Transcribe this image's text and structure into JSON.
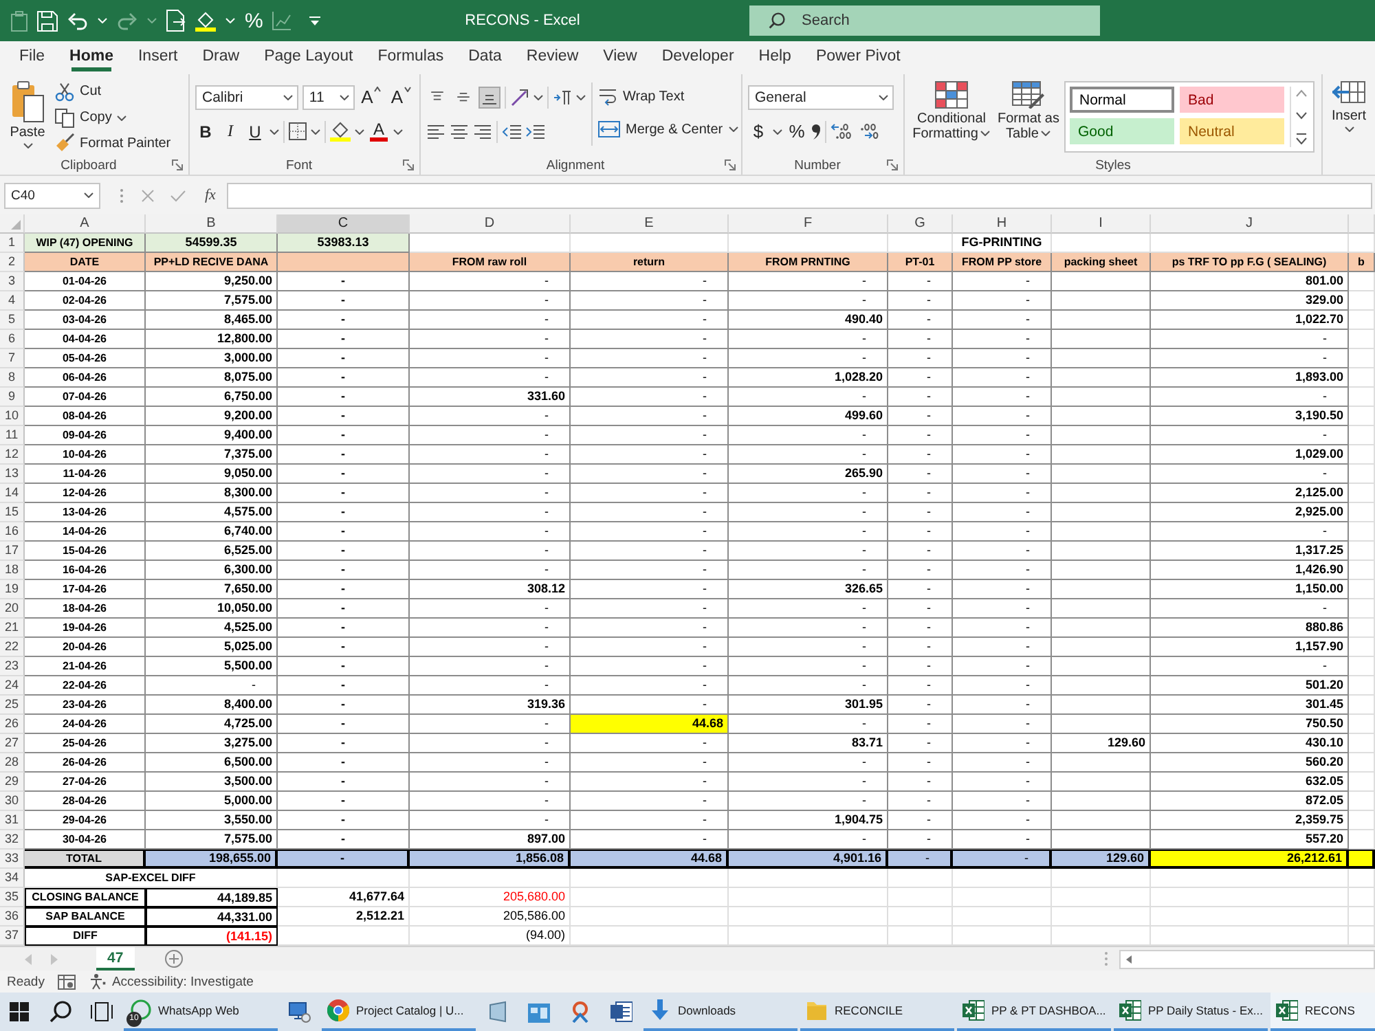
{
  "window": {
    "title": "RECONS - Excel"
  },
  "quick_access": {
    "percent": "%"
  },
  "search": {
    "placeholder": "Search"
  },
  "ribbon_tabs": [
    {
      "label": "File",
      "selected": false
    },
    {
      "label": "Home",
      "selected": true
    },
    {
      "label": "Insert",
      "selected": false
    },
    {
      "label": "Draw",
      "selected": false
    },
    {
      "label": "Page Layout",
      "selected": false
    },
    {
      "label": "Formulas",
      "selected": false
    },
    {
      "label": "Data",
      "selected": false
    },
    {
      "label": "Review",
      "selected": false
    },
    {
      "label": "View",
      "selected": false
    },
    {
      "label": "Developer",
      "selected": false
    },
    {
      "label": "Help",
      "selected": false
    },
    {
      "label": "Power Pivot",
      "selected": false
    }
  ],
  "clipboard": {
    "paste": "Paste",
    "cut": "Cut",
    "copy": "Copy",
    "format_painter": "Format Painter",
    "label": "Clipboard"
  },
  "font": {
    "name": "Calibri",
    "size": "11",
    "grow": "A",
    "shrink": "A",
    "bold": "B",
    "italic": "I",
    "underline": "U",
    "font_color": "A",
    "label": "Font"
  },
  "alignment": {
    "vertical": [
      {
        "selected": false
      },
      {
        "selected": false
      },
      {
        "selected": true
      }
    ],
    "wrap_text": "Wrap Text",
    "merge_center": "Merge & Center",
    "label": "Alignment"
  },
  "number": {
    "format": "General",
    "currency": "$",
    "percent": "%",
    "label": "Number"
  },
  "styles": {
    "conditional_formatting": "Conditional Formatting",
    "format_as_table": "Format as Table",
    "gallery": [
      {
        "label": "Normal",
        "kind": "normal",
        "selected": true
      },
      {
        "label": "Bad",
        "kind": "bad",
        "selected": false
      },
      {
        "label": "Good",
        "kind": "good",
        "selected": false
      },
      {
        "label": "Neutral",
        "kind": "neutral",
        "selected": false
      }
    ],
    "label": "Styles"
  },
  "cells": {
    "insert": "Insert"
  },
  "formula_bar": {
    "name_box": "C40",
    "insert_function": "fx"
  },
  "sheet": {
    "columns": [
      {
        "letter": "A",
        "selected": false
      },
      {
        "letter": "B",
        "selected": false
      },
      {
        "letter": "C",
        "selected": true
      },
      {
        "letter": "D",
        "selected": false
      },
      {
        "letter": "E",
        "selected": false
      },
      {
        "letter": "F",
        "selected": false
      },
      {
        "letter": "G",
        "selected": false
      },
      {
        "letter": "H",
        "selected": false
      },
      {
        "letter": "I",
        "selected": false
      },
      {
        "letter": "J",
        "selected": false
      }
    ],
    "rows": [
      {
        "number": "1",
        "kind": "opening",
        "cells": {
          "A": "WIP (47) OPENING",
          "B": "54599.35",
          "C": "53983.13",
          "H": "FG-PRINTING"
        }
      },
      {
        "number": "2",
        "kind": "header",
        "cells": {
          "A": "DATE",
          "B": "PP+LD RECIVE DANA",
          "D": "FROM raw roll",
          "E": "return",
          "F": "FROM PRNTING",
          "G": "PT-01",
          "H": "FROM PP store",
          "I": "packing sheet",
          "J": "ps TRF TO pp F.G ( SEALING)",
          "K": "b"
        }
      },
      {
        "number": "3",
        "kind": "data",
        "cells": {
          "A": "01-04-26",
          "B": "9,250.00",
          "C": "-",
          "D": "-",
          "E": "-",
          "F": "-",
          "G": "-",
          "H": "-",
          "J": "801.00"
        }
      },
      {
        "number": "4",
        "kind": "data",
        "cells": {
          "A": "02-04-26",
          "B": "7,575.00",
          "C": "-",
          "D": "-",
          "E": "-",
          "F": "-",
          "G": "-",
          "H": "-",
          "J": "329.00"
        }
      },
      {
        "number": "5",
        "kind": "data",
        "cells": {
          "A": "03-04-26",
          "B": "8,465.00",
          "C": "-",
          "D": "-",
          "E": "-",
          "F": "490.40",
          "G": "-",
          "H": "-",
          "J": "1,022.70"
        }
      },
      {
        "number": "6",
        "kind": "data",
        "cells": {
          "A": "04-04-26",
          "B": "12,800.00",
          "C": "-",
          "D": "-",
          "E": "-",
          "F": "-",
          "G": "-",
          "H": "-",
          "J": "-"
        }
      },
      {
        "number": "7",
        "kind": "data",
        "cells": {
          "A": "05-04-26",
          "B": "3,000.00",
          "C": "-",
          "D": "-",
          "E": "-",
          "F": "-",
          "G": "-",
          "H": "-",
          "J": "-"
        }
      },
      {
        "number": "8",
        "kind": "data",
        "cells": {
          "A": "06-04-26",
          "B": "8,075.00",
          "C": "-",
          "D": "-",
          "E": "-",
          "F": "1,028.20",
          "G": "-",
          "H": "-",
          "J": "1,893.00"
        }
      },
      {
        "number": "9",
        "kind": "data",
        "cells": {
          "A": "07-04-26",
          "B": "6,750.00",
          "C": "-",
          "D": "331.60",
          "E": "-",
          "F": "-",
          "G": "-",
          "H": "-",
          "J": "-"
        }
      },
      {
        "number": "10",
        "kind": "data",
        "cells": {
          "A": "08-04-26",
          "B": "9,200.00",
          "C": "-",
          "D": "-",
          "E": "-",
          "F": "499.60",
          "G": "-",
          "H": "-",
          "J": "3,190.50"
        }
      },
      {
        "number": "11",
        "kind": "data",
        "cells": {
          "A": "09-04-26",
          "B": "9,400.00",
          "C": "-",
          "D": "-",
          "E": "-",
          "F": "-",
          "G": "-",
          "H": "-",
          "J": "-"
        }
      },
      {
        "number": "12",
        "kind": "data",
        "cells": {
          "A": "10-04-26",
          "B": "7,375.00",
          "C": "-",
          "D": "-",
          "E": "-",
          "F": "-",
          "G": "-",
          "H": "-",
          "J": "1,029.00"
        }
      },
      {
        "number": "13",
        "kind": "data",
        "cells": {
          "A": "11-04-26",
          "B": "9,050.00",
          "C": "-",
          "D": "-",
          "E": "-",
          "F": "265.90",
          "G": "-",
          "H": "-",
          "J": "-"
        }
      },
      {
        "number": "14",
        "kind": "data",
        "cells": {
          "A": "12-04-26",
          "B": "8,300.00",
          "C": "-",
          "D": "-",
          "E": "-",
          "F": "-",
          "G": "-",
          "H": "-",
          "J": "2,125.00"
        }
      },
      {
        "number": "15",
        "kind": "data",
        "cells": {
          "A": "13-04-26",
          "B": "4,575.00",
          "C": "-",
          "D": "-",
          "E": "-",
          "F": "-",
          "G": "-",
          "H": "-",
          "J": "2,925.00"
        }
      },
      {
        "number": "16",
        "kind": "data",
        "cells": {
          "A": "14-04-26",
          "B": "6,740.00",
          "C": "-",
          "D": "-",
          "E": "-",
          "F": "-",
          "G": "-",
          "H": "-",
          "J": "-"
        }
      },
      {
        "number": "17",
        "kind": "data",
        "cells": {
          "A": "15-04-26",
          "B": "6,525.00",
          "C": "-",
          "D": "-",
          "E": "-",
          "F": "-",
          "G": "-",
          "H": "-",
          "J": "1,317.25"
        }
      },
      {
        "number": "18",
        "kind": "data",
        "cells": {
          "A": "16-04-26",
          "B": "6,300.00",
          "C": "-",
          "D": "-",
          "E": "-",
          "F": "-",
          "G": "-",
          "H": "-",
          "J": "1,426.90"
        }
      },
      {
        "number": "19",
        "kind": "data",
        "cells": {
          "A": "17-04-26",
          "B": "7,650.00",
          "C": "-",
          "D": "308.12",
          "E": "-",
          "F": "326.65",
          "G": "-",
          "H": "-",
          "J": "1,150.00"
        }
      },
      {
        "number": "20",
        "kind": "data",
        "cells": {
          "A": "18-04-26",
          "B": "10,050.00",
          "C": "-",
          "D": "-",
          "E": "-",
          "F": "-",
          "G": "-",
          "H": "-",
          "J": "-"
        }
      },
      {
        "number": "21",
        "kind": "data",
        "cells": {
          "A": "19-04-26",
          "B": "4,525.00",
          "C": "-",
          "D": "-",
          "E": "-",
          "F": "-",
          "G": "-",
          "H": "-",
          "J": "880.86"
        }
      },
      {
        "number": "22",
        "kind": "data",
        "cells": {
          "A": "20-04-26",
          "B": "5,025.00",
          "C": "-",
          "D": "-",
          "E": "-",
          "F": "-",
          "G": "-",
          "H": "-",
          "J": "1,157.90"
        }
      },
      {
        "number": "23",
        "kind": "data",
        "cells": {
          "A": "21-04-26",
          "B": "5,500.00",
          "C": "-",
          "D": "-",
          "E": "-",
          "F": "-",
          "G": "-",
          "H": "-",
          "J": "-"
        }
      },
      {
        "number": "24",
        "kind": "data",
        "cells": {
          "A": "22-04-26",
          "B": "-",
          "C": "-",
          "D": "-",
          "E": "-",
          "F": "-",
          "G": "-",
          "H": "-",
          "J": "501.20"
        }
      },
      {
        "number": "25",
        "kind": "data",
        "cells": {
          "A": "23-04-26",
          "B": "8,400.00",
          "C": "-",
          "D": "319.36",
          "E": "-",
          "F": "301.95",
          "G": "-",
          "H": "-",
          "J": "301.45"
        }
      },
      {
        "number": "26",
        "kind": "data",
        "cells": {
          "A": "24-04-26",
          "B": "4,725.00",
          "C": "-",
          "D": "-",
          "E": {
            "text": "44.68",
            "kind": "highlight",
            "color": "#ffff00"
          },
          "F": "-",
          "G": "-",
          "H": "-",
          "J": "750.50"
        }
      },
      {
        "number": "27",
        "kind": "data",
        "cells": {
          "A": "25-04-26",
          "B": "3,275.00",
          "C": "-",
          "D": "-",
          "E": "-",
          "F": "83.71",
          "G": "-",
          "H": "-",
          "I": "129.60",
          "J": "430.10"
        }
      },
      {
        "number": "28",
        "kind": "data",
        "cells": {
          "A": "26-04-26",
          "B": "6,500.00",
          "C": "-",
          "D": "-",
          "E": "-",
          "F": "-",
          "G": "-",
          "H": "-",
          "J": "560.20"
        }
      },
      {
        "number": "29",
        "kind": "data",
        "cells": {
          "A": "27-04-26",
          "B": "3,500.00",
          "C": "-",
          "D": "-",
          "E": "-",
          "F": "-",
          "G": "-",
          "H": "-",
          "J": "632.05"
        }
      },
      {
        "number": "30",
        "kind": "data",
        "cells": {
          "A": "28-04-26",
          "B": "5,000.00",
          "C": "-",
          "D": "-",
          "E": "-",
          "F": "-",
          "G": "-",
          "H": "-",
          "J": "872.05"
        }
      },
      {
        "number": "31",
        "kind": "data",
        "cells": {
          "A": "29-04-26",
          "B": "3,550.00",
          "C": "-",
          "D": "-",
          "E": "-",
          "F": "1,904.75",
          "G": "-",
          "H": "-",
          "J": "2,359.75"
        }
      },
      {
        "number": "32",
        "kind": "data",
        "cells": {
          "A": "30-04-26",
          "B": "7,575.00",
          "C": "-",
          "D": "897.00",
          "E": "-",
          "F": "-",
          "G": "-",
          "H": "-",
          "J": "557.20"
        }
      },
      {
        "number": "33",
        "kind": "total",
        "cells": {
          "A": "TOTAL",
          "B": "198,655.00",
          "C": "-",
          "D": "1,856.08",
          "E": "44.68",
          "F": "4,901.16",
          "G": "-",
          "H": "-",
          "I": "129.60",
          "J": {
            "text": "26,212.61",
            "kind": "highlight",
            "color": "#ffff00"
          },
          "K": {
            "kind": "highlight",
            "color": "#ffff00"
          }
        }
      },
      {
        "number": "34",
        "kind": "merged",
        "cells": {
          "A": "SAP-EXCEL DIFF"
        }
      },
      {
        "number": "35",
        "kind": "balance",
        "cells": {
          "A": "CLOSING BALANCE",
          "B": "44,189.85",
          "C": "41,677.64",
          "D": {
            "text": "205,680.00",
            "kind": "text",
            "color": "#ff0000"
          }
        }
      },
      {
        "number": "36",
        "kind": "balance",
        "cells": {
          "A": "SAP BALANCE",
          "B": "44,331.00",
          "C": "2,512.21",
          "D": "205,586.00"
        }
      },
      {
        "number": "37",
        "kind": "balance",
        "cells": {
          "A": "DIFF",
          "B": {
            "text": "(141.15)",
            "kind": "text",
            "color": "#ff0000"
          },
          "D": "(94.00)"
        }
      }
    ]
  },
  "sheet_tabs": [
    {
      "label": "47",
      "selected": true
    }
  ],
  "status_bar": {
    "mode": "Ready",
    "accessibility": "Accessibility: Investigate"
  },
  "taskbar": {
    "apps": [
      {
        "label": "WhatsApp Web",
        "kind": "chat",
        "badge": "10",
        "selected": false
      },
      {
        "label": "Project Catalog | U...",
        "kind": "browser",
        "selected": false
      },
      {
        "label": "Downloads",
        "kind": "downloads",
        "selected": false
      },
      {
        "label": "RECONCILE",
        "kind": "folder",
        "selected": false
      },
      {
        "label": "PP & PT DASHBOA...",
        "kind": "spreadsheet",
        "selected": false
      },
      {
        "label": "PP Daily Status - Ex...",
        "kind": "spreadsheet",
        "selected": false
      },
      {
        "label": "RECONS",
        "kind": "spreadsheet",
        "selected": true
      }
    ]
  }
}
